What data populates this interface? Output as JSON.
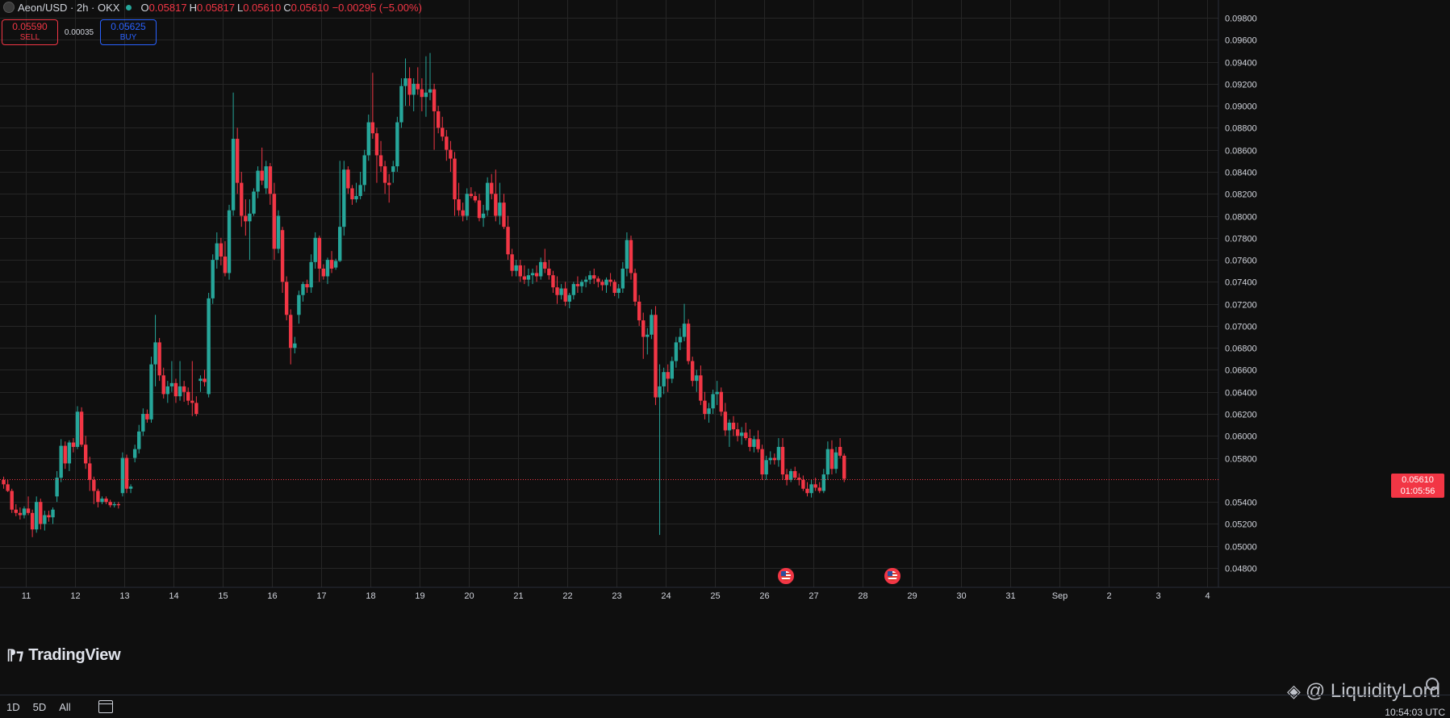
{
  "header": {
    "symbol_title": "Aeon/USD · 2h · OKX",
    "ohlc": {
      "o_label": "O",
      "o_value": "0.05817",
      "h_label": "H",
      "h_value": "0.05817",
      "l_label": "L",
      "l_value": "0.05610",
      "c_label": "C",
      "c_value": "0.05610",
      "change": "−0.00295 (−5.00%)"
    },
    "status_dot_color": "#26a69a"
  },
  "trade": {
    "sell_price": "0.05590",
    "sell_label": "SELL",
    "spread": "0.00035",
    "buy_price": "0.05625",
    "buy_label": "BUY"
  },
  "last_price": {
    "price": "0.05610",
    "countdown": "01:05:56"
  },
  "branding": {
    "logo_text": "TradingView",
    "watermark": "@ LiquidityLord"
  },
  "bottom_bar": {
    "ranges": [
      "1D",
      "5D",
      "All"
    ],
    "clock": "10:54:03 UTC"
  },
  "events": [
    {
      "icon": "us-flag-icon",
      "date": "26",
      "x_day": 26.45
    },
    {
      "icon": "us-flag-icon",
      "date": "28",
      "x_day": 28.6
    }
  ],
  "colors": {
    "up": "#26a69a",
    "down": "#f23645",
    "background": "#0f0f0f",
    "grid": "#2a2a2a"
  },
  "chart_data": {
    "type": "candlestick",
    "y_range": [
      0.047,
      0.099
    ],
    "y_ticks": [
      "0.04800",
      "0.05000",
      "0.05200",
      "0.05400",
      "0.05800",
      "0.06000",
      "0.06200",
      "0.06400",
      "0.06600",
      "0.06800",
      "0.07000",
      "0.07200",
      "0.07400",
      "0.07600",
      "0.07800",
      "0.08000",
      "0.08200",
      "0.08400",
      "0.08600",
      "0.08800",
      "0.09000",
      "0.09200",
      "0.09400",
      "0.09600",
      "0.09800"
    ],
    "x_ticks": [
      {
        "label": "11",
        "day": 11
      },
      {
        "label": "12",
        "day": 12
      },
      {
        "label": "13",
        "day": 13
      },
      {
        "label": "14",
        "day": 14
      },
      {
        "label": "15",
        "day": 15
      },
      {
        "label": "16",
        "day": 16
      },
      {
        "label": "17",
        "day": 17
      },
      {
        "label": "18",
        "day": 18
      },
      {
        "label": "19",
        "day": 19
      },
      {
        "label": "20",
        "day": 20
      },
      {
        "label": "21",
        "day": 21
      },
      {
        "label": "22",
        "day": 22
      },
      {
        "label": "23",
        "day": 23
      },
      {
        "label": "24",
        "day": 24
      },
      {
        "label": "25",
        "day": 25
      },
      {
        "label": "26",
        "day": 26
      },
      {
        "label": "27",
        "day": 27
      },
      {
        "label": "28",
        "day": 28
      },
      {
        "label": "29",
        "day": 29
      },
      {
        "label": "30",
        "day": 30
      },
      {
        "label": "31",
        "day": 31
      },
      {
        "label": "Sep",
        "day": 32
      },
      {
        "label": "2",
        "day": 33
      },
      {
        "label": "3",
        "day": 34
      },
      {
        "label": "4",
        "day": 35
      }
    ],
    "start_day": 10.55,
    "candle_interval_days": 0.0833,
    "candles": [
      [
        0.056,
        0.0563,
        0.0552,
        0.0556
      ],
      [
        0.0556,
        0.056,
        0.0549,
        0.055
      ],
      [
        0.055,
        0.0552,
        0.053,
        0.0533
      ],
      [
        0.0533,
        0.0538,
        0.0527,
        0.053
      ],
      [
        0.053,
        0.0535,
        0.0524,
        0.0528
      ],
      [
        0.0528,
        0.0536,
        0.0525,
        0.0534
      ],
      [
        0.0534,
        0.0545,
        0.0528,
        0.053
      ],
      [
        0.053,
        0.0533,
        0.0508,
        0.0515
      ],
      [
        0.0515,
        0.0545,
        0.0512,
        0.054
      ],
      [
        0.054,
        0.0543,
        0.0515,
        0.052
      ],
      [
        0.052,
        0.0532,
        0.0514,
        0.0528
      ],
      [
        0.0528,
        0.0532,
        0.0522,
        0.0526
      ],
      [
        0.0526,
        0.0535,
        0.052,
        0.0533
      ],
      [
        0.0545,
        0.0568,
        0.054,
        0.0562
      ],
      [
        0.0562,
        0.0597,
        0.0558,
        0.0591
      ],
      [
        0.0591,
        0.0595,
        0.057,
        0.0575
      ],
      [
        0.0575,
        0.0596,
        0.0568,
        0.0594
      ],
      [
        0.0594,
        0.0598,
        0.0585,
        0.059
      ],
      [
        0.059,
        0.0627,
        0.0588,
        0.0622
      ],
      [
        0.0622,
        0.0626,
        0.059,
        0.0592
      ],
      [
        0.0592,
        0.06,
        0.057,
        0.0575
      ],
      [
        0.0575,
        0.0581,
        0.055,
        0.056
      ],
      [
        0.056,
        0.0563,
        0.0538,
        0.055
      ],
      [
        0.055,
        0.0552,
        0.0535,
        0.054
      ],
      [
        0.054,
        0.0545,
        0.0538,
        0.0543
      ],
      [
        0.0543,
        0.0545,
        0.0538,
        0.054
      ],
      [
        0.054,
        0.0542,
        0.0535,
        0.0537
      ],
      [
        0.0537,
        0.054,
        0.0535,
        0.0538
      ],
      [
        0.0538,
        0.054,
        0.0534,
        0.0537
      ],
      [
        0.0548,
        0.0585,
        0.0545,
        0.058
      ],
      [
        0.058,
        0.0583,
        0.0548,
        0.0552
      ],
      [
        0.0552,
        0.0556,
        0.0548,
        0.0554
      ],
      [
        0.058,
        0.0592,
        0.0576,
        0.0588
      ],
      [
        0.0588,
        0.061,
        0.0584,
        0.0604
      ],
      [
        0.0604,
        0.0625,
        0.06,
        0.062
      ],
      [
        0.062,
        0.0624,
        0.0612,
        0.0615
      ],
      [
        0.0615,
        0.0672,
        0.0612,
        0.0665
      ],
      [
        0.0665,
        0.071,
        0.0645,
        0.0685
      ],
      [
        0.0685,
        0.0689,
        0.065,
        0.0655
      ],
      [
        0.0655,
        0.0662,
        0.0634,
        0.0638
      ],
      [
        0.0638,
        0.065,
        0.063,
        0.0645
      ],
      [
        0.0645,
        0.0668,
        0.064,
        0.0648
      ],
      [
        0.0648,
        0.0652,
        0.063,
        0.0636
      ],
      [
        0.0636,
        0.0668,
        0.0632,
        0.0645
      ],
      [
        0.0645,
        0.065,
        0.0631,
        0.064
      ],
      [
        0.064,
        0.0644,
        0.0628,
        0.0632
      ],
      [
        0.0632,
        0.0668,
        0.0618,
        0.063
      ],
      [
        0.063,
        0.0636,
        0.0618,
        0.062
      ],
      [
        0.065,
        0.0655,
        0.064,
        0.0652
      ],
      [
        0.0652,
        0.066,
        0.0645,
        0.0649
      ],
      [
        0.0638,
        0.073,
        0.0635,
        0.0725
      ],
      [
        0.0725,
        0.0765,
        0.072,
        0.076
      ],
      [
        0.076,
        0.0785,
        0.0752,
        0.0775
      ],
      [
        0.0775,
        0.078,
        0.0755,
        0.0763
      ],
      [
        0.0763,
        0.0777,
        0.0745,
        0.0748
      ],
      [
        0.0748,
        0.081,
        0.0742,
        0.0805
      ],
      [
        0.0805,
        0.0912,
        0.08,
        0.087
      ],
      [
        0.087,
        0.088,
        0.082,
        0.083
      ],
      [
        0.083,
        0.084,
        0.079,
        0.08
      ],
      [
        0.08,
        0.0815,
        0.0782,
        0.0795
      ],
      [
        0.0795,
        0.0815,
        0.076,
        0.0802
      ],
      [
        0.0802,
        0.0825,
        0.08,
        0.0822
      ],
      [
        0.0822,
        0.0845,
        0.0816,
        0.0841
      ],
      [
        0.0841,
        0.0862,
        0.0828,
        0.0832
      ],
      [
        0.0825,
        0.085,
        0.082,
        0.0845
      ],
      [
        0.0845,
        0.0848,
        0.081,
        0.082
      ],
      [
        0.082,
        0.083,
        0.076,
        0.077
      ],
      [
        0.077,
        0.0805,
        0.0766,
        0.08
      ],
      [
        0.0787,
        0.079,
        0.073,
        0.074
      ],
      [
        0.074,
        0.0745,
        0.0705,
        0.071
      ],
      [
        0.071,
        0.0715,
        0.0665,
        0.068
      ],
      [
        0.068,
        0.069,
        0.0675,
        0.0684
      ],
      [
        0.071,
        0.0732,
        0.0702,
        0.0728
      ],
      [
        0.0728,
        0.074,
        0.0722,
        0.0738
      ],
      [
        0.0738,
        0.0742,
        0.073,
        0.0735
      ],
      [
        0.0735,
        0.0765,
        0.073,
        0.0758
      ],
      [
        0.0758,
        0.0785,
        0.0752,
        0.078
      ],
      [
        0.078,
        0.0782,
        0.074,
        0.0752
      ],
      [
        0.0752,
        0.0756,
        0.0742,
        0.0745
      ],
      [
        0.0745,
        0.0762,
        0.0738,
        0.076
      ],
      [
        0.076,
        0.0768,
        0.0748,
        0.0752
      ],
      [
        0.0753,
        0.0761,
        0.0751,
        0.0759
      ],
      [
        0.0759,
        0.085,
        0.0758,
        0.079
      ],
      [
        0.079,
        0.085,
        0.0782,
        0.0842
      ],
      [
        0.0842,
        0.0845,
        0.082,
        0.0825
      ],
      [
        0.0825,
        0.0828,
        0.081,
        0.0815
      ],
      [
        0.0815,
        0.083,
        0.0812,
        0.0818
      ],
      [
        0.0818,
        0.084,
        0.0815,
        0.0828
      ],
      [
        0.0828,
        0.086,
        0.0822,
        0.0855
      ],
      [
        0.0855,
        0.0892,
        0.085,
        0.0885
      ],
      [
        0.0885,
        0.093,
        0.087,
        0.0875
      ],
      [
        0.0875,
        0.088,
        0.083,
        0.0855
      ],
      [
        0.0855,
        0.0868,
        0.084,
        0.0845
      ],
      [
        0.0845,
        0.085,
        0.082,
        0.083
      ],
      [
        0.083,
        0.0838,
        0.0812,
        0.0828
      ],
      [
        0.084,
        0.085,
        0.083,
        0.0845
      ],
      [
        0.0845,
        0.089,
        0.084,
        0.0885
      ],
      [
        0.0885,
        0.0925,
        0.088,
        0.0918
      ],
      [
        0.0918,
        0.0943,
        0.09,
        0.0925
      ],
      [
        0.0925,
        0.0935,
        0.09,
        0.091
      ],
      [
        0.091,
        0.0925,
        0.0895,
        0.092
      ],
      [
        0.092,
        0.0935,
        0.091,
        0.0915
      ],
      [
        0.0915,
        0.0925,
        0.0895,
        0.0908
      ],
      [
        0.0908,
        0.0945,
        0.089,
        0.0912
      ],
      [
        0.0912,
        0.0948,
        0.0905,
        0.0915
      ],
      [
        0.0915,
        0.092,
        0.086,
        0.0895
      ],
      [
        0.0895,
        0.09,
        0.0875,
        0.088
      ],
      [
        0.088,
        0.089,
        0.0868,
        0.0872
      ],
      [
        0.0872,
        0.0878,
        0.085,
        0.086
      ],
      [
        0.086,
        0.0868,
        0.084,
        0.0852
      ],
      [
        0.0852,
        0.0858,
        0.08,
        0.0815
      ],
      [
        0.0815,
        0.083,
        0.08,
        0.0805
      ],
      [
        0.0805,
        0.0812,
        0.0795,
        0.08
      ],
      [
        0.08,
        0.0825,
        0.0796,
        0.082
      ],
      [
        0.082,
        0.0826,
        0.0816,
        0.0818
      ],
      [
        0.0818,
        0.0822,
        0.0812,
        0.0814
      ],
      [
        0.0814,
        0.082,
        0.0795,
        0.0798
      ],
      [
        0.0798,
        0.081,
        0.079,
        0.0802
      ],
      [
        0.0805,
        0.0835,
        0.08,
        0.083
      ],
      [
        0.083,
        0.0838,
        0.0815,
        0.082
      ],
      [
        0.082,
        0.0842,
        0.0795,
        0.08
      ],
      [
        0.08,
        0.083,
        0.0792,
        0.0812
      ],
      [
        0.0812,
        0.082,
        0.0788,
        0.079
      ],
      [
        0.079,
        0.08,
        0.076,
        0.0765
      ],
      [
        0.0765,
        0.077,
        0.0745,
        0.075
      ],
      [
        0.075,
        0.076,
        0.0745,
        0.0755
      ],
      [
        0.0755,
        0.076,
        0.074,
        0.0745
      ],
      [
        0.0745,
        0.0755,
        0.0738,
        0.0742
      ],
      [
        0.0742,
        0.0752,
        0.0736,
        0.0746
      ],
      [
        0.0746,
        0.0752,
        0.0738,
        0.0748
      ],
      [
        0.0748,
        0.0755,
        0.074,
        0.0745
      ],
      [
        0.0745,
        0.0762,
        0.0742,
        0.0758
      ],
      [
        0.0758,
        0.077,
        0.0748,
        0.0752
      ],
      [
        0.0752,
        0.076,
        0.0742,
        0.0746
      ],
      [
        0.0746,
        0.075,
        0.073,
        0.0735
      ],
      [
        0.0735,
        0.0745,
        0.072,
        0.0728
      ],
      [
        0.0728,
        0.0738,
        0.0724,
        0.0734
      ],
      [
        0.0734,
        0.074,
        0.0718,
        0.0722
      ],
      [
        0.0722,
        0.073,
        0.0716,
        0.0728
      ],
      [
        0.0728,
        0.074,
        0.0724,
        0.0738
      ],
      [
        0.0738,
        0.0745,
        0.073,
        0.0736
      ],
      [
        0.0736,
        0.0742,
        0.073,
        0.074
      ],
      [
        0.074,
        0.0745,
        0.0735,
        0.0742
      ],
      [
        0.0742,
        0.075,
        0.0738,
        0.0746
      ],
      [
        0.0746,
        0.0752,
        0.0738,
        0.0743
      ],
      [
        0.0743,
        0.0745,
        0.0735,
        0.074
      ],
      [
        0.074,
        0.0742,
        0.0732,
        0.0737
      ],
      [
        0.0737,
        0.0744,
        0.073,
        0.0742
      ],
      [
        0.0742,
        0.0748,
        0.0736,
        0.074
      ],
      [
        0.074,
        0.0742,
        0.0727,
        0.073
      ],
      [
        0.073,
        0.0738,
        0.0725,
        0.0734
      ],
      [
        0.0734,
        0.0758,
        0.073,
        0.0752
      ],
      [
        0.0752,
        0.0785,
        0.0745,
        0.0778
      ],
      [
        0.0778,
        0.0782,
        0.0742,
        0.0748
      ],
      [
        0.0748,
        0.0752,
        0.0718,
        0.0722
      ],
      [
        0.0722,
        0.0728,
        0.07,
        0.0705
      ],
      [
        0.0705,
        0.0712,
        0.067,
        0.069
      ],
      [
        0.069,
        0.0698,
        0.0674,
        0.0692
      ],
      [
        0.0692,
        0.0715,
        0.0688,
        0.071
      ],
      [
        0.071,
        0.0718,
        0.0628,
        0.0635
      ],
      [
        0.0635,
        0.0665,
        0.051,
        0.0645
      ],
      [
        0.0645,
        0.0662,
        0.0638,
        0.0658
      ],
      [
        0.0658,
        0.0665,
        0.064,
        0.0652
      ],
      [
        0.0652,
        0.0672,
        0.0648,
        0.0668
      ],
      [
        0.0668,
        0.069,
        0.0662,
        0.0685
      ],
      [
        0.0685,
        0.0698,
        0.0678,
        0.069
      ],
      [
        0.069,
        0.072,
        0.0686,
        0.0702
      ],
      [
        0.0702,
        0.0706,
        0.0665,
        0.0668
      ],
      [
        0.0668,
        0.0672,
        0.0645,
        0.065
      ],
      [
        0.065,
        0.066,
        0.064,
        0.0655
      ],
      [
        0.0655,
        0.0664,
        0.0628,
        0.0632
      ],
      [
        0.0632,
        0.064,
        0.0615,
        0.062
      ],
      [
        0.062,
        0.063,
        0.0612,
        0.0625
      ],
      [
        0.0625,
        0.0642,
        0.062,
        0.0638
      ],
      [
        0.0638,
        0.065,
        0.0628,
        0.064
      ],
      [
        0.064,
        0.0644,
        0.0618,
        0.0622
      ],
      [
        0.0622,
        0.063,
        0.06,
        0.0605
      ],
      [
        0.0605,
        0.0615,
        0.059,
        0.0612
      ],
      [
        0.0612,
        0.0618,
        0.06,
        0.0606
      ],
      [
        0.0606,
        0.0612,
        0.0595,
        0.06
      ],
      [
        0.06,
        0.0608,
        0.0592,
        0.0603
      ],
      [
        0.0603,
        0.0612,
        0.0596,
        0.0598
      ],
      [
        0.0598,
        0.0606,
        0.0586,
        0.059
      ],
      [
        0.059,
        0.06,
        0.0585,
        0.0597
      ],
      [
        0.0597,
        0.0605,
        0.0585,
        0.0588
      ],
      [
        0.0588,
        0.0592,
        0.056,
        0.0565
      ],
      [
        0.0565,
        0.0582,
        0.056,
        0.0578
      ],
      [
        0.0578,
        0.0586,
        0.0574,
        0.058
      ],
      [
        0.058,
        0.0584,
        0.0574,
        0.0578
      ],
      [
        0.0578,
        0.0598,
        0.0572,
        0.059
      ],
      [
        0.059,
        0.0598,
        0.056,
        0.0565
      ],
      [
        0.0565,
        0.057,
        0.0555,
        0.056
      ],
      [
        0.056,
        0.057,
        0.0558,
        0.0568
      ],
      [
        0.0568,
        0.0572,
        0.056,
        0.0562
      ],
      [
        0.0562,
        0.0566,
        0.0555,
        0.056
      ],
      [
        0.056,
        0.0564,
        0.055,
        0.0552
      ],
      [
        0.0552,
        0.0558,
        0.0545,
        0.0548
      ],
      [
        0.0548,
        0.056,
        0.0544,
        0.0556
      ],
      [
        0.0556,
        0.0562,
        0.055,
        0.0553
      ],
      [
        0.0553,
        0.0558,
        0.0548,
        0.055
      ],
      [
        0.055,
        0.057,
        0.0548,
        0.0565
      ],
      [
        0.0565,
        0.0595,
        0.056,
        0.0588
      ],
      [
        0.0588,
        0.0596,
        0.0565,
        0.057
      ],
      [
        0.057,
        0.059,
        0.0566,
        0.0585
      ],
      [
        0.059,
        0.0598,
        0.058,
        0.0582
      ],
      [
        0.0582,
        0.0584,
        0.0558,
        0.0561
      ]
    ]
  }
}
